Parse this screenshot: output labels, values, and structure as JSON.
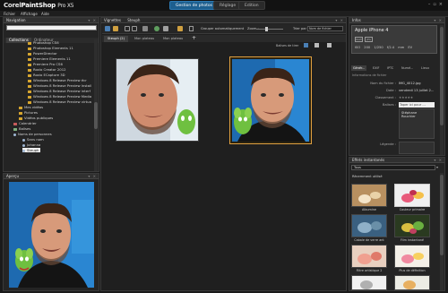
{
  "app": {
    "title_prefix": "Corel",
    "title_bold": "PaintShop",
    "title_suffix": "Pro X5"
  },
  "workspace_tabs": [
    {
      "label": "Gestion de photos",
      "active": true
    },
    {
      "label": "Réglage",
      "active": false
    },
    {
      "label": "Edition",
      "active": false
    }
  ],
  "menu": [
    "Fichier",
    "Affichage",
    "Aide"
  ],
  "navigation": {
    "title": "Navigation",
    "tabs": [
      "Collections",
      "Ordinateur"
    ],
    "items": [
      {
        "label": "Photoshop CS6",
        "icon": "folder-icon"
      },
      {
        "label": "Photoshop Elements 11",
        "icon": "folder-icon"
      },
      {
        "label": "PowerDirector",
        "icon": "folder-icon"
      },
      {
        "label": "Premiere Elements 11",
        "icon": "folder-icon"
      },
      {
        "label": "Premiere Pro CS6",
        "icon": "folder-icon"
      },
      {
        "label": "Roxio Creator 2012",
        "icon": "folder-icon"
      },
      {
        "label": "Roxio ECapture 3D",
        "icon": "folder-icon"
      },
      {
        "label": "Windows 8 Release Preview écr",
        "icon": "folder-icon"
      },
      {
        "label": "Windows 8 Release Preview Install",
        "icon": "folder-icon"
      },
      {
        "label": "Windows 8 Release Preview interf",
        "icon": "folder-icon"
      },
      {
        "label": "Windows 8 Release Preview Media",
        "icon": "folder-icon"
      },
      {
        "label": "Windows 8 Release Preview virtua",
        "icon": "folder-icon"
      },
      {
        "label": "Mes vidéos",
        "icon": "folder-icon"
      },
      {
        "label": "Pictures",
        "icon": "folder-icon"
      },
      {
        "label": "Vidéos publiques",
        "icon": "folder-icon"
      },
      {
        "label": "Calendrier",
        "icon": "calendar-icon"
      },
      {
        "label": "Balises",
        "icon": "tag-icon"
      },
      {
        "label": "Noms de personnes",
        "icon": "people-icon"
      },
      {
        "label": "Sans nom",
        "icon": "person-icon"
      },
      {
        "label": "Johanna",
        "icon": "person-icon"
      },
      {
        "label": "Steuph",
        "icon": "person-icon",
        "selected": true
      }
    ]
  },
  "preview": {
    "title": "Aperçu"
  },
  "browser": {
    "tabs": [
      "Vignettes",
      "Steuph"
    ],
    "toolbar": {
      "group_label": "Grouper automatiquement",
      "zoom_label": "Zoom :",
      "sort_label": "Trier par :",
      "sort_value": "Nom de fichier"
    },
    "album_tabs": [
      "Steuph (2)",
      "Mon plateau",
      "Mon plateau"
    ],
    "trays_label": "Balises de tirer",
    "add_tab": "+"
  },
  "info": {
    "title": "Infos",
    "camera": "Apple iPhone 4",
    "badges": [
      "RAW",
      "JPG"
    ],
    "exposure": [
      "ISO 200",
      "1/250",
      "f/2.4",
      "mm",
      "EV"
    ],
    "tabs": [
      "Génér...",
      "EXIF",
      "IPTC",
      "Numé...",
      "Lieux"
    ],
    "section": "Informations de fichier",
    "fields": [
      {
        "label": "Nom du fichier :",
        "value": "IMG_4012.jpg"
      },
      {
        "label": "Date :",
        "value": "vendredi 13 juillet 2..."
      },
      {
        "label": "Classement :",
        "value": "★★★★★"
      },
      {
        "label": "Balises :",
        "value": "Taper ici pour ..."
      },
      {
        "label": "",
        "value": "Stéphane Rouchier"
      },
      {
        "label": "Légende :",
        "value": ""
      }
    ]
  },
  "effects": {
    "title": "Effets instantanés",
    "dropdown": "Tous",
    "section": "Récemment utilisé",
    "items": [
      {
        "label": "Albumine"
      },
      {
        "label": "Couleur primaire"
      },
      {
        "label": "Cabale de verre ant"
      },
      {
        "label": "Film instantané"
      },
      {
        "label": "Filtre artistique 2"
      },
      {
        "label": "Plus de définition"
      }
    ]
  },
  "colors": {
    "accent": "#1d5f8f",
    "folder": "#d7a62f",
    "selection_border": "#e0a040"
  }
}
